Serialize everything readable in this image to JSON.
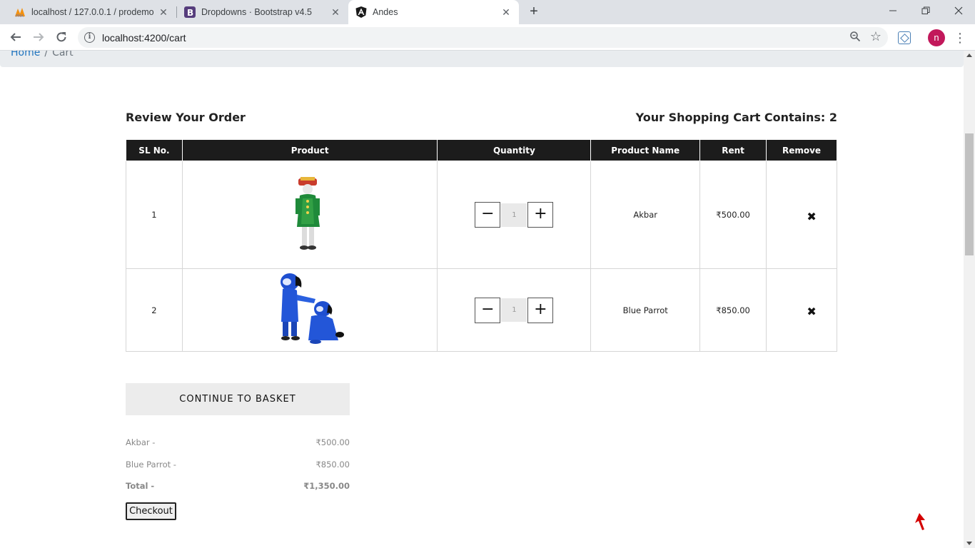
{
  "browser": {
    "tabs": [
      {
        "title": "localhost / 127.0.0.1 / prodemo /",
        "favicon": "phpmyadmin-icon"
      },
      {
        "title": "Dropdowns · Bootstrap v4.5",
        "favicon": "bootstrap-icon"
      },
      {
        "title": "Andes",
        "favicon": "angular-icon"
      }
    ],
    "url": "localhost:4200/cart",
    "profile_initial": "n"
  },
  "breadcrumb": {
    "home": "Home",
    "sep": "/",
    "current": "Cart"
  },
  "review_title": "Review Your Order",
  "cart_count_text": "Your Shopping Cart Contains: 2",
  "table": {
    "headers": [
      "SL No.",
      "Product",
      "Quantity",
      "Product Name",
      "Rent",
      "Remove"
    ],
    "rows": [
      {
        "sl": "1",
        "qty": "1",
        "name": "Akbar",
        "rent": "₹500.00"
      },
      {
        "sl": "2",
        "qty": "1",
        "name": "Blue Parrot",
        "rent": "₹850.00"
      }
    ]
  },
  "continue_label": "CONTINUE TO BASKET",
  "summary": [
    {
      "label": "Akbar -",
      "value": "₹500.00"
    },
    {
      "label": "Blue Parrot -",
      "value": "₹850.00"
    },
    {
      "label": "Total -",
      "value": "₹1,350.00"
    }
  ],
  "checkout_label": "Checkout",
  "colors": {
    "header_bg": "#1c1c1c",
    "link": "#1e73be",
    "avatar": "#c2185b"
  }
}
